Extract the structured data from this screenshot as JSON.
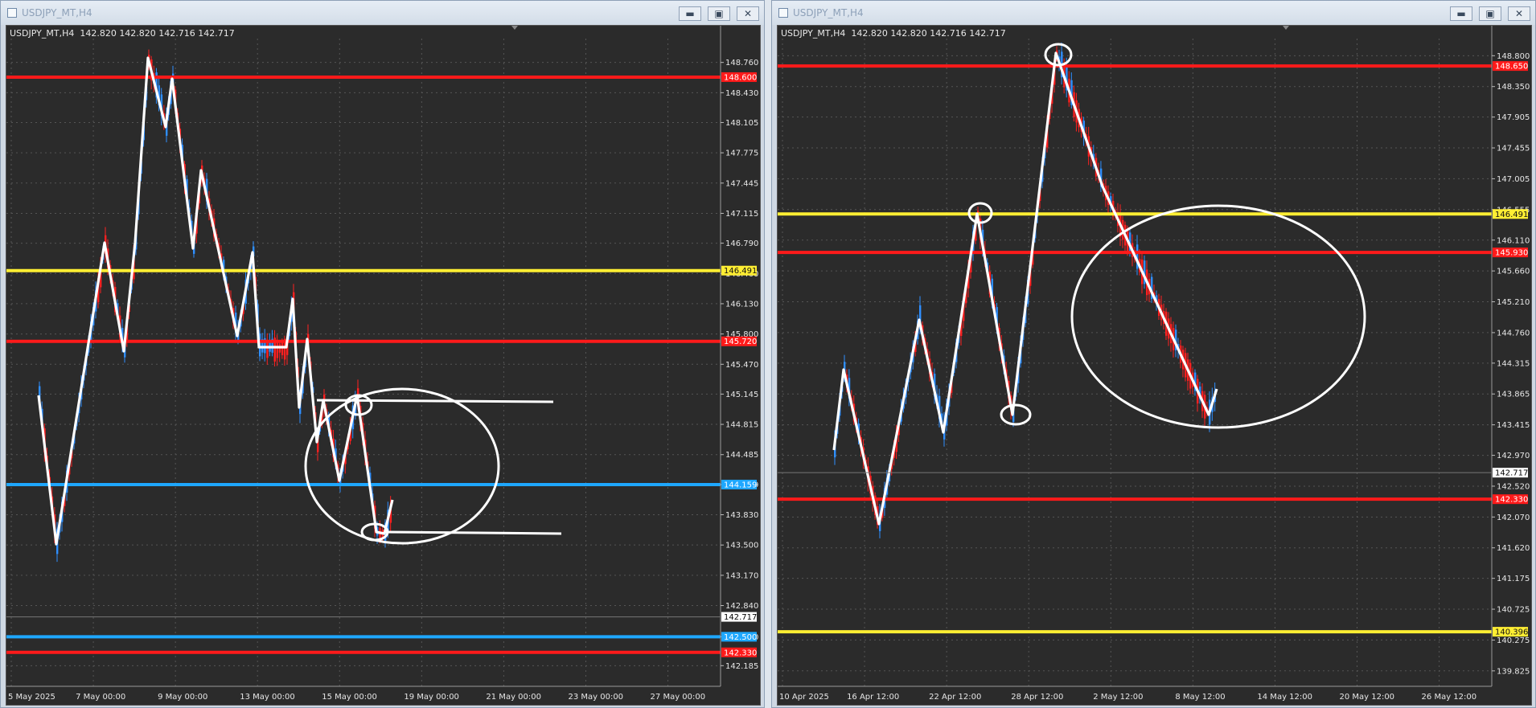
{
  "windows": [
    {
      "title": "USDJPY_MT,H4",
      "info_line": "USDJPY_MT,H4  142.820 142.820 142.716 142.717",
      "current_price": "142.717",
      "price_min": 141.96,
      "price_max": 149.02,
      "price_ticks": [
        "148.760",
        "148.430",
        "148.105",
        "147.775",
        "147.445",
        "147.115",
        "146.790",
        "146.460",
        "146.130",
        "145.800",
        "145.470",
        "145.145",
        "144.815",
        "144.485",
        "144.159",
        "143.830",
        "143.500",
        "143.170",
        "142.840",
        "142.500",
        "142.185"
      ],
      "time_labels": [
        "5 May 2025",
        "7 May 00:00",
        "9 May 00:00",
        "13 May 00:00",
        "15 May 00:00",
        "19 May 00:00",
        "21 May 00:00",
        "23 May 00:00",
        "27 May 00:00"
      ],
      "levels": [
        {
          "price": 148.6,
          "color": "#ff1a1a",
          "label": "148.600"
        },
        {
          "price": 146.491,
          "color": "#ffee33",
          "label": "146.491"
        },
        {
          "price": 145.72,
          "color": "#ff1a1a",
          "label": "145.720"
        },
        {
          "price": 144.159,
          "color": "#1ea7ff",
          "label": "144.159"
        },
        {
          "price": 142.5,
          "color": "#1ea7ff",
          "label": "142.500"
        },
        {
          "price": 142.33,
          "color": "#ff1a1a",
          "label": "142.330"
        }
      ]
    },
    {
      "title": "USDJPY_MT,H4",
      "info_line": "USDJPY_MT,H4  142.820 142.820 142.716 142.717",
      "current_price": "142.717",
      "price_min": 139.6,
      "price_max": 149.05,
      "price_ticks": [
        "148.800",
        "148.350",
        "147.905",
        "147.455",
        "147.005",
        "146.555",
        "146.110",
        "145.660",
        "145.210",
        "144.760",
        "144.315",
        "143.865",
        "143.415",
        "142.970",
        "142.520",
        "142.070",
        "141.620",
        "141.175",
        "140.725",
        "140.275",
        "139.825"
      ],
      "time_labels": [
        "10 Apr 2025",
        "16 Apr 12:00",
        "22 Apr 12:00",
        "28 Apr 12:00",
        "2 May 12:00",
        "8 May 12:00",
        "14 May 12:00",
        "20 May 12:00",
        "26 May 12:00"
      ],
      "levels": [
        {
          "price": 148.65,
          "color": "#ff1a1a",
          "label": "148.650"
        },
        {
          "price": 146.491,
          "color": "#ffee33",
          "label": "146.491"
        },
        {
          "price": 145.93,
          "color": "#ff1a1a",
          "label": "145.930"
        },
        {
          "price": 142.33,
          "color": "#ff1a1a",
          "label": "142.330"
        },
        {
          "price": 140.396,
          "color": "#ffee33",
          "label": "140.396"
        }
      ]
    }
  ]
}
